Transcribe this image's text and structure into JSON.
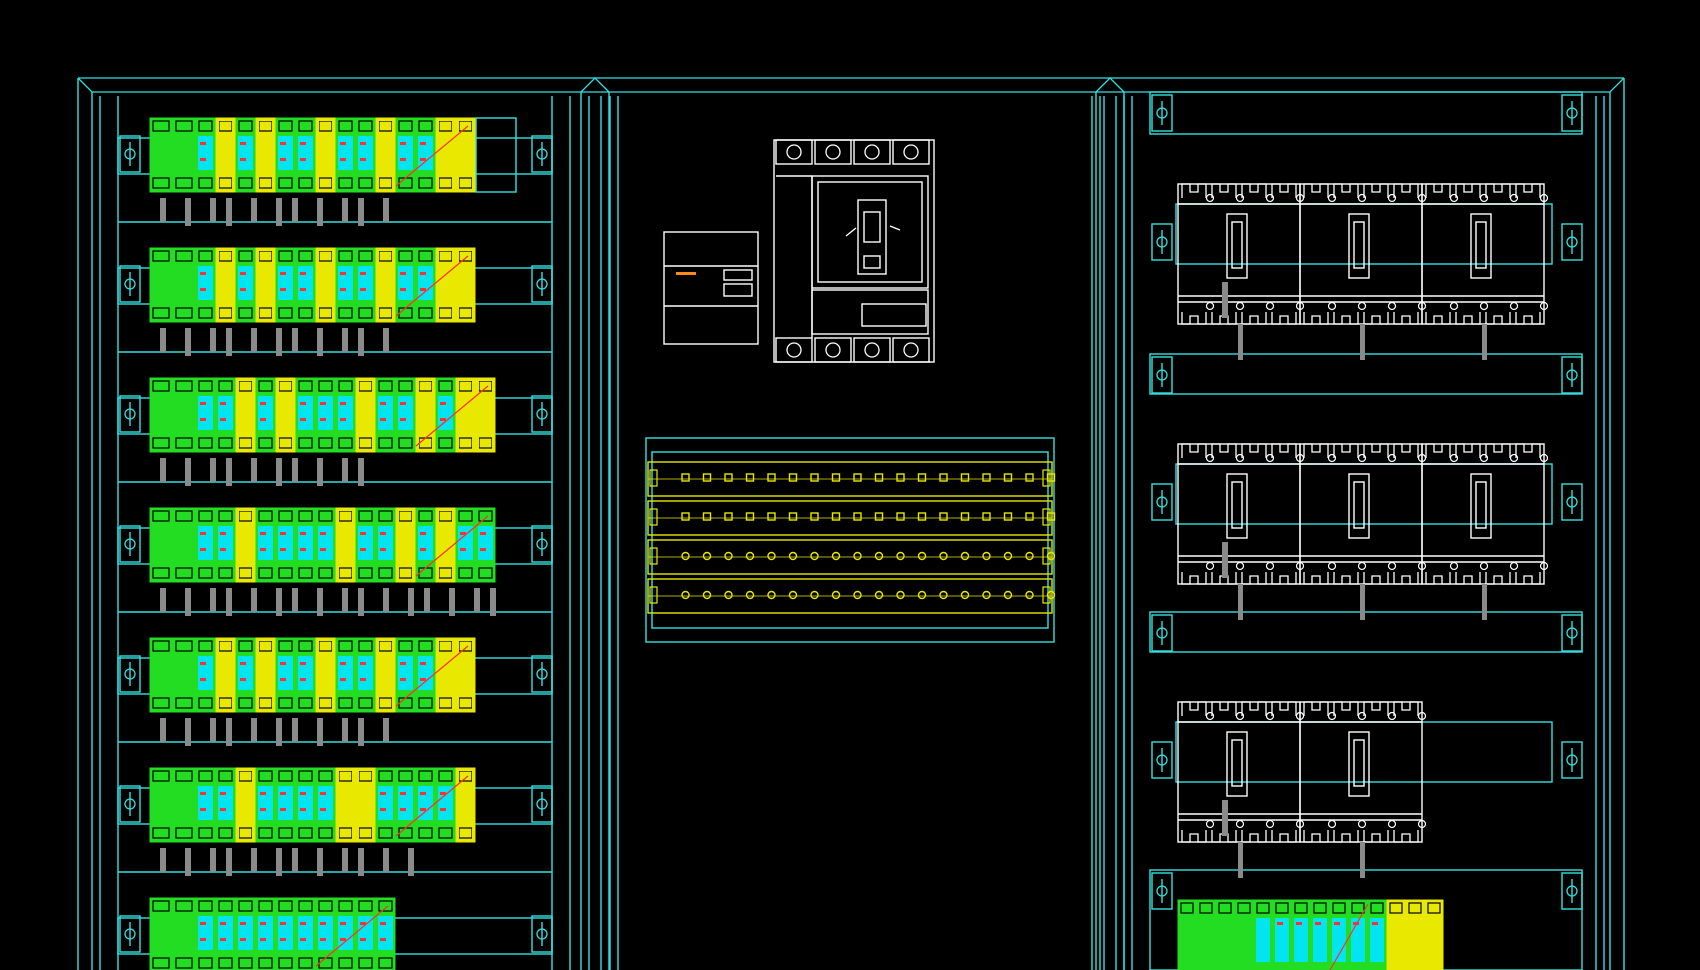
{
  "drawing": {
    "kind": "electrical cabinet layout (CAD)",
    "background": "#000000",
    "colors": {
      "frame": "#33e0e0",
      "module_green": "#22dd22",
      "module_yellow": "#e8e800",
      "module_cyan": "#00e5f0",
      "contact_red": "#ff3030",
      "wire_grey": "#8a8a8a",
      "device_white": "#ffffff",
      "accent_orange": "#ff8a1a"
    },
    "icons": [
      "din-rail-clamp-icon",
      "breaker-handle-icon",
      "terminal-screw-icon"
    ]
  },
  "left_panel": {
    "rows": [
      {
        "modules": [
          "G",
          "G",
          "G",
          "Y",
          "G",
          "Y",
          "G",
          "G",
          "Y",
          "G",
          "G",
          "Y",
          "G",
          "G",
          "Y",
          "Y"
        ],
        "spare_outline": true,
        "wires": 11
      },
      {
        "modules": [
          "G",
          "G",
          "G",
          "Y",
          "G",
          "Y",
          "G",
          "G",
          "Y",
          "G",
          "G",
          "Y",
          "G",
          "G",
          "Y",
          "Y"
        ],
        "spare_outline": false,
        "wires": 11
      },
      {
        "modules": [
          "G",
          "G",
          "G",
          "G",
          "Y",
          "G",
          "Y",
          "G",
          "G",
          "G",
          "Y",
          "G",
          "G",
          "Y",
          "G",
          "Y",
          "Y"
        ],
        "spare_outline": false,
        "wires": 10
      },
      {
        "modules": [
          "G",
          "G",
          "G",
          "G",
          "Y",
          "G",
          "G",
          "G",
          "G",
          "Y",
          "G",
          "G",
          "Y",
          "G",
          "Y",
          "G",
          "G"
        ],
        "spare_outline": false,
        "wires": 16
      },
      {
        "modules": [
          "G",
          "G",
          "G",
          "Y",
          "G",
          "Y",
          "G",
          "G",
          "Y",
          "G",
          "G",
          "Y",
          "G",
          "G",
          "Y",
          "Y"
        ],
        "spare_outline": false,
        "wires": 11
      },
      {
        "modules": [
          "G",
          "G",
          "G",
          "G",
          "Y",
          "G",
          "G",
          "G",
          "G",
          "Y",
          "Y",
          "G",
          "G",
          "G",
          "G",
          "Y"
        ],
        "spare_outline": false,
        "wires": 12
      },
      {
        "modules": [
          "G",
          "G",
          "G",
          "G",
          "G",
          "G",
          "G",
          "G",
          "G",
          "G",
          "G",
          "G"
        ],
        "spare_outline": false,
        "wires": 0
      }
    ]
  },
  "middle_panel": {
    "small_box": true,
    "main_breaker": {
      "poles": 4
    },
    "terminal_block": {
      "rows": 4,
      "terminals_per_row": 18
    }
  },
  "right_panel": {
    "breaker_rows": [
      {
        "breakers": 3
      },
      {
        "breakers": 3
      },
      {
        "breakers": 2
      }
    ],
    "bottom_strip": {
      "modules": 14,
      "yellow_tail": 3
    }
  }
}
